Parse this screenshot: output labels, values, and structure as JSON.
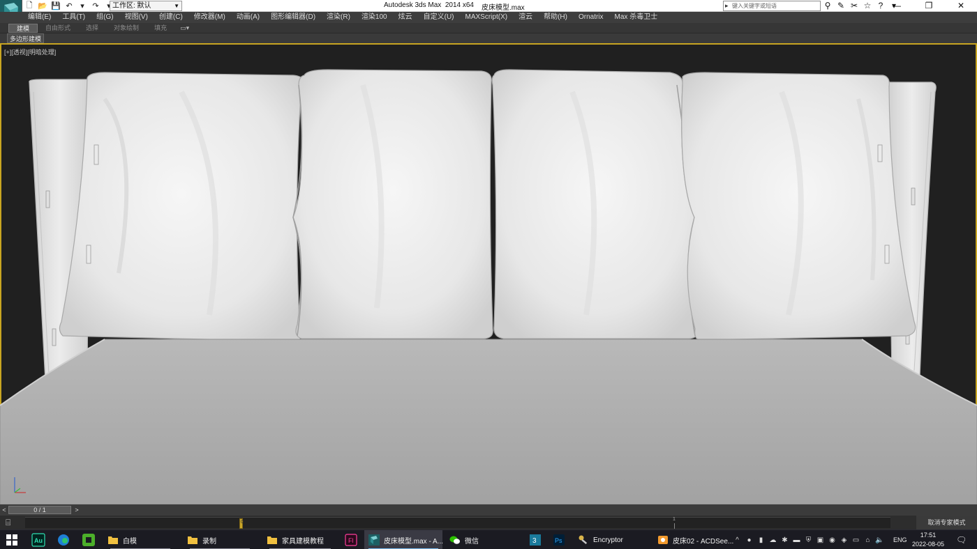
{
  "titlebar": {
    "workspace_label": "工作区: 默认",
    "app_title": "Autodesk 3ds Max  2014 x64",
    "file_name": "皮床模型.max",
    "search_placeholder": "键入关键字或短语",
    "window_controls": [
      "—",
      "❐",
      "✕"
    ]
  },
  "menu": {
    "items": [
      "编辑(E)",
      "工具(T)",
      "组(G)",
      "视图(V)",
      "创建(C)",
      "修改器(M)",
      "动画(A)",
      "图形编辑器(D)",
      "渲染(R)",
      "渲染100",
      "炫云",
      "自定义(U)",
      "MAXScript(X)",
      "渲云",
      "帮助(H)",
      "Ornatrix",
      "Max 杀毒卫士"
    ]
  },
  "ribbon": {
    "tabs": [
      "建模",
      "自由形式",
      "选择",
      "对象绘制",
      "填充"
    ],
    "active_tab": "建模",
    "sub_tab": "多边形建模"
  },
  "viewport": {
    "label_plus": "[+]",
    "label_view": "[透视]",
    "label_shading": "[明暗处理]",
    "border_color": "#c8a521",
    "background": "#202020",
    "axis_icon": "xyz-axis-icon"
  },
  "timeline": {
    "frame_counter": "0 / 1",
    "prev_label": "<",
    "next_label": ">",
    "tick_start": "0",
    "tick_end": "1",
    "expert_mode": "取消专家模式"
  },
  "taskbar": {
    "items": [
      {
        "label": "白模",
        "icon": "folder-icon"
      },
      {
        "label": "录制",
        "icon": "folder-icon"
      },
      {
        "label": "家具建模教程",
        "icon": "folder-icon"
      },
      {
        "label": "皮床模型.max - A...",
        "icon": "3dsmax-icon"
      },
      {
        "label": "微信",
        "icon": "wechat-icon"
      },
      {
        "label": "Encryptor",
        "icon": "encryptor-icon"
      },
      {
        "label": "皮床02 - ACDSee...",
        "icon": "acdsee-icon"
      }
    ],
    "lang": "ENG",
    "time": "17:51",
    "date": "2022-08-05"
  }
}
